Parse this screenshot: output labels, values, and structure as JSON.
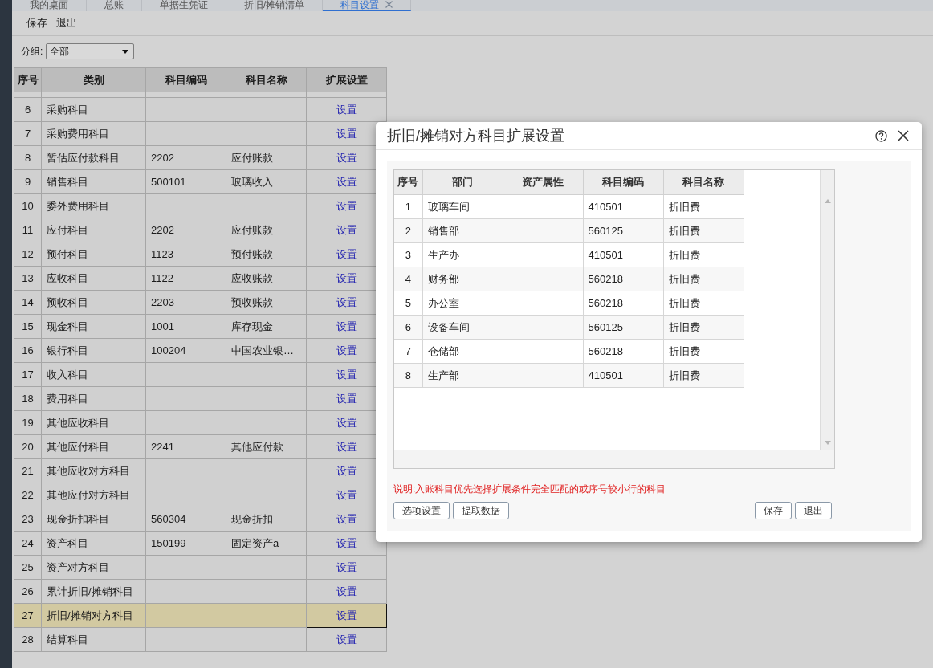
{
  "tabs": [
    {
      "label": "我的桌面",
      "selected": false,
      "closable": false
    },
    {
      "label": "总账",
      "selected": false,
      "closable": false
    },
    {
      "label": "单据生凭证",
      "selected": false,
      "closable": false
    },
    {
      "label": "折旧/摊销清单",
      "selected": false,
      "closable": false
    },
    {
      "label": "科目设置",
      "selected": true,
      "closable": true
    }
  ],
  "toolbar": {
    "buttons": [
      "保存",
      "退出"
    ]
  },
  "filter": {
    "label": "分组:",
    "value": "全部"
  },
  "table": {
    "columns": [
      "序号",
      "类别",
      "科目编码",
      "科目名称",
      "扩展设置"
    ],
    "rows": [
      {
        "no": "6",
        "category": "采购科目",
        "action": "设置",
        "selected": false
      },
      {
        "no": "7",
        "category": "采购费用科目",
        "action": "设置",
        "selected": false
      },
      {
        "no": "8",
        "category": "暂估应付款科目",
        "code": "2202",
        "name": "应付账款",
        "action": "设置",
        "selected": false
      },
      {
        "no": "9",
        "category": "销售科目",
        "code": "500101",
        "name": "玻璃收入",
        "action": "设置",
        "selected": false
      },
      {
        "no": "10",
        "category": "委外费用科目",
        "action": "设置",
        "selected": false
      },
      {
        "no": "11",
        "category": "应付科目",
        "code": "2202",
        "name": "应付账款",
        "action": "设置",
        "selected": false
      },
      {
        "no": "12",
        "category": "预付科目",
        "code": "1123",
        "name": "预付账款",
        "action": "设置",
        "selected": false
      },
      {
        "no": "13",
        "category": "应收科目",
        "code": "1122",
        "name": "应收账款",
        "action": "设置",
        "selected": false
      },
      {
        "no": "14",
        "category": "预收科目",
        "code": "2203",
        "name": "预收账款",
        "action": "设置",
        "selected": false
      },
      {
        "no": "15",
        "category": "现金科目",
        "code": "1001",
        "name": "库存现金",
        "action": "设置",
        "selected": false
      },
      {
        "no": "16",
        "category": "银行科目",
        "code": "100204",
        "name": "中国农业银…",
        "action": "设置",
        "selected": false
      },
      {
        "no": "17",
        "category": "收入科目",
        "action": "设置",
        "selected": false
      },
      {
        "no": "18",
        "category": "费用科目",
        "action": "设置",
        "selected": false
      },
      {
        "no": "19",
        "category": "其他应收科目",
        "action": "设置",
        "selected": false
      },
      {
        "no": "20",
        "category": "其他应付科目",
        "code": "2241",
        "name": "其他应付款",
        "action": "设置",
        "selected": false
      },
      {
        "no": "21",
        "category": "其他应收对方科目",
        "action": "设置",
        "selected": false
      },
      {
        "no": "22",
        "category": "其他应付对方科目",
        "action": "设置",
        "selected": false
      },
      {
        "no": "23",
        "category": "现金折扣科目",
        "code": "560304",
        "name": "现金折扣",
        "action": "设置",
        "selected": false
      },
      {
        "no": "24",
        "category": "资产科目",
        "code": "150199",
        "name": "固定资产a",
        "action": "设置",
        "selected": false
      },
      {
        "no": "25",
        "category": "资产对方科目",
        "action": "设置",
        "selected": false
      },
      {
        "no": "26",
        "category": "累计折旧/摊销科目",
        "action": "设置",
        "selected": false
      },
      {
        "no": "27",
        "category": "折旧/摊销对方科目",
        "action": "设置",
        "selected": true
      },
      {
        "no": "28",
        "category": "结算科目",
        "action": "设置",
        "selected": false
      }
    ]
  },
  "dialog": {
    "title": "折旧/摊销对方科目扩展设置",
    "grid": {
      "columns": [
        "序号",
        "部门",
        "资产属性",
        "科目编码",
        "科目名称"
      ],
      "rows": [
        {
          "no": "1",
          "department": "玻璃车间",
          "code": "410501",
          "name": "折旧费"
        },
        {
          "no": "2",
          "department": "销售部",
          "code": "560125",
          "name": "折旧费"
        },
        {
          "no": "3",
          "department": "生产办",
          "code": "410501",
          "name": "折旧费"
        },
        {
          "no": "4",
          "department": "财务部",
          "code": "560218",
          "name": "折旧费"
        },
        {
          "no": "5",
          "department": "办公室",
          "code": "560218",
          "name": "折旧费"
        },
        {
          "no": "6",
          "department": "设备车间",
          "code": "560125",
          "name": "折旧费"
        },
        {
          "no": "7",
          "department": "仓储部",
          "code": "560218",
          "name": "折旧费"
        },
        {
          "no": "8",
          "department": "生产部",
          "code": "410501",
          "name": "折旧费"
        }
      ]
    },
    "note": "说明:入账科目优先选择扩展条件完全匹配的或序号较小行的科目",
    "left_buttons": [
      "选项设置",
      "提取数据"
    ],
    "right_buttons": [
      "保存",
      "退出"
    ]
  }
}
